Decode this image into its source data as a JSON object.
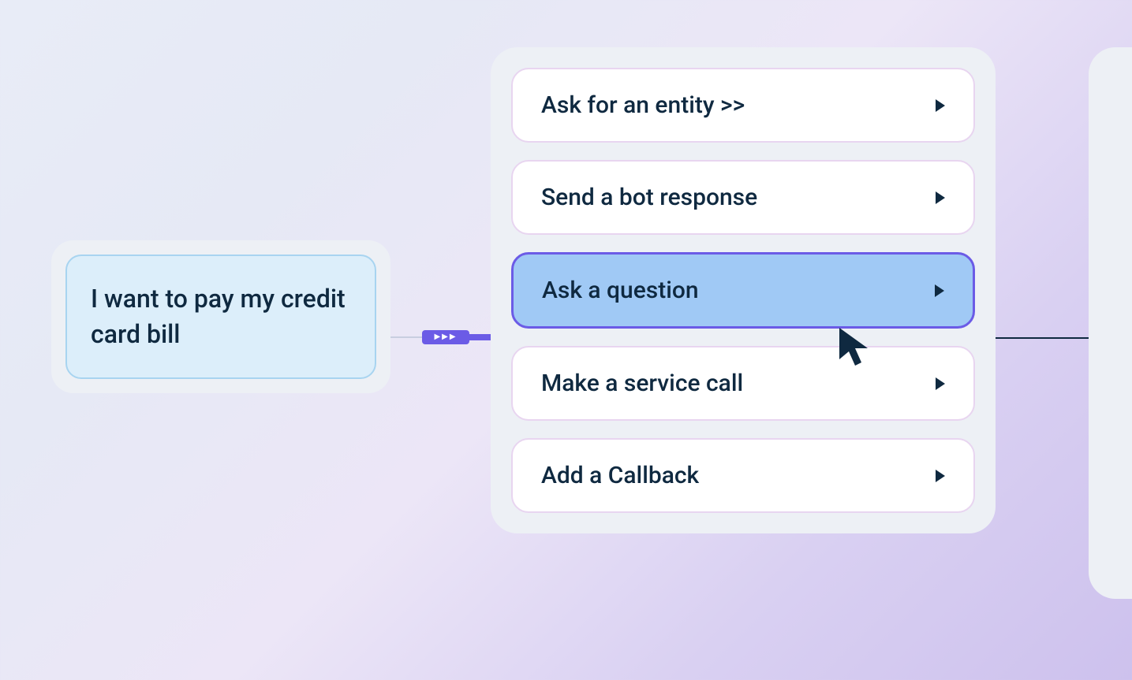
{
  "intent": {
    "text": "I want to pay my credit card bill"
  },
  "options": [
    {
      "label": "Ask for an entity >>",
      "selected": false
    },
    {
      "label": "Send a bot response",
      "selected": false
    },
    {
      "label": "Ask a question",
      "selected": true
    },
    {
      "label": "Make a service call",
      "selected": false
    },
    {
      "label": "Add a Callback",
      "selected": false
    }
  ],
  "colors": {
    "accent": "#6b5be6",
    "selected_bg": "#a0c9f5",
    "text": "#0f2940"
  }
}
